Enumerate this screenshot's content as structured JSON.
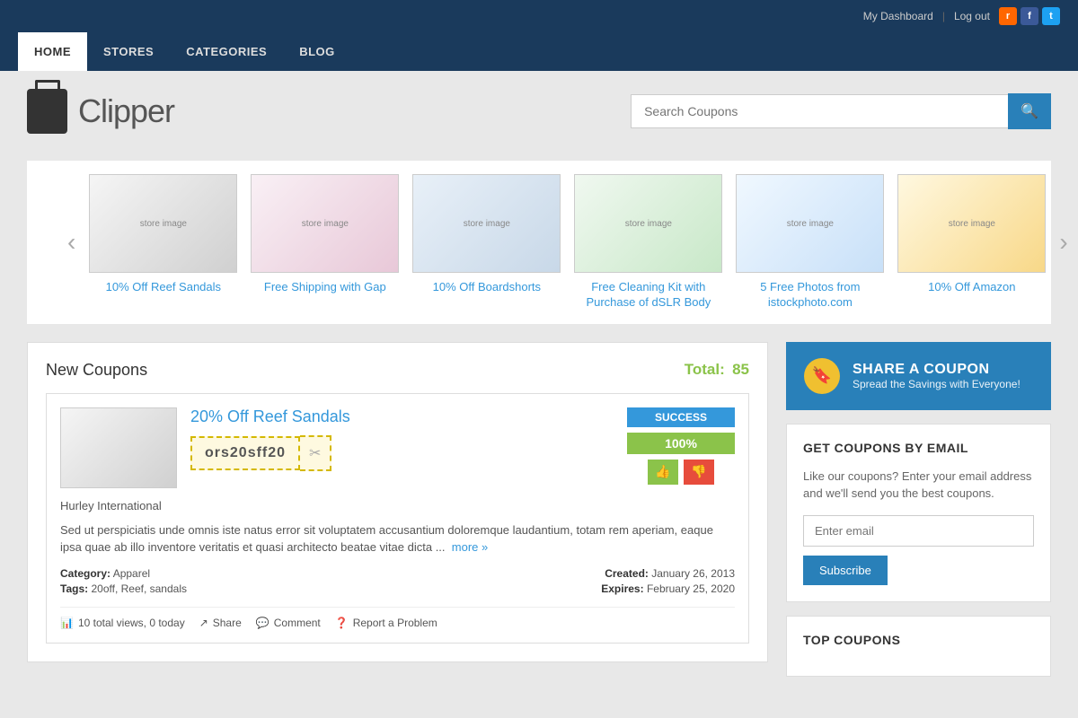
{
  "topbar": {
    "dashboard_link": "My Dashboard",
    "logout_link": "Log out"
  },
  "nav": {
    "items": [
      {
        "label": "HOME",
        "active": true
      },
      {
        "label": "STORES",
        "active": false
      },
      {
        "label": "CATEGORIES",
        "active": false
      },
      {
        "label": "BLOG",
        "active": false
      }
    ]
  },
  "header": {
    "logo_text": "Clipper",
    "search_placeholder": "Search Coupons"
  },
  "carousel": {
    "items": [
      {
        "label": "10% Off Reef Sandals",
        "img_class": "img1"
      },
      {
        "label": "Free Shipping with Gap",
        "img_class": "img2"
      },
      {
        "label": "10% Off Boardshorts",
        "img_class": "img3"
      },
      {
        "label": "Free Cleaning Kit with Purchase of dSLR Body",
        "img_class": "img4"
      },
      {
        "label": "5 Free Photos from istockphoto.com",
        "img_class": "img5"
      },
      {
        "label": "10% Off Amazon",
        "img_class": "img6"
      }
    ]
  },
  "new_coupons": {
    "title": "New Coupons",
    "total_label": "Total:",
    "total_count": "85"
  },
  "coupon": {
    "title": "20% Off Reef Sandals",
    "code": "ors20sff20",
    "success_label": "SUCCESS",
    "success_pct": "100%",
    "store": "Hurley International",
    "description": "Sed ut perspiciatis unde omnis iste natus error sit voluptatem accusantium doloremque laudantium, totam rem aperiam, eaque ipsa quae ab illo inventore veritatis et quasi architecto beatae vitae dicta ...",
    "more_link": "more »",
    "category_label": "Category:",
    "category_value": "Apparel",
    "tags_label": "Tags:",
    "tags_value": "20off, Reef, sandals",
    "created_label": "Created:",
    "created_value": "January 26, 2013",
    "expires_label": "Expires:",
    "expires_value": "February 25, 2020",
    "views": "10 total views, 0 today",
    "share_label": "Share",
    "comment_label": "Comment",
    "report_label": "Report a Problem"
  },
  "sidebar": {
    "share_title": "SHARE A COUPON",
    "share_sub": "Spread the Savings with Everyone!",
    "email_section_title": "GET COUPONS BY EMAIL",
    "email_desc": "Like our coupons? Enter your email address and we'll send you the best coupons.",
    "email_placeholder": "Enter email",
    "subscribe_label": "Subscribe",
    "top_coupons_title": "TOP COUPONS"
  }
}
